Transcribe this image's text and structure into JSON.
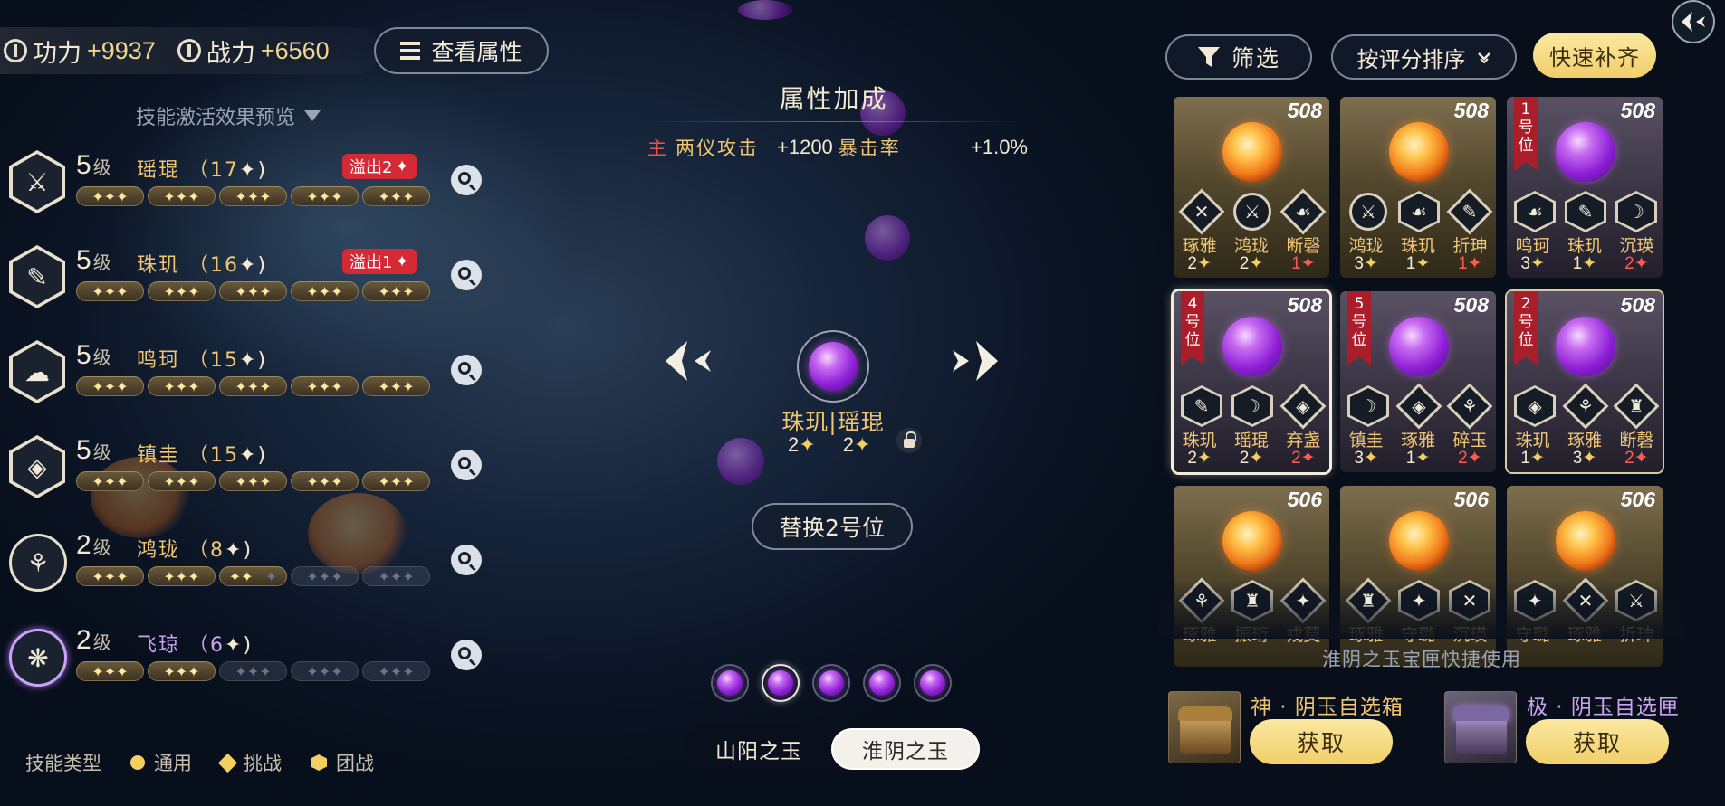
{
  "stats": {
    "gongli_label": "功力",
    "gongli_value": "+9937",
    "zhanli_label": "战力",
    "zhanli_value": "+6560",
    "view_attr_button": "查看属性"
  },
  "skill_preview": {
    "title": "技能激活效果预览",
    "level_unit": "级",
    "skills": [
      {
        "level": "5",
        "name": "瑶琨",
        "count": "（17",
        "overflow": "溢出2",
        "segments_on": 5
      },
      {
        "level": "5",
        "name": "珠玑",
        "count": "（16",
        "overflow": "溢出1",
        "segments_on": 5
      },
      {
        "level": "5",
        "name": "鸣珂",
        "count": "（15",
        "overflow": "",
        "segments_on": 5
      },
      {
        "level": "5",
        "name": "镇圭",
        "count": "（15",
        "overflow": "",
        "segments_on": 5
      },
      {
        "level": "2",
        "name": "鸿珑",
        "count": "（8",
        "overflow": "",
        "segments_on": 2.67
      },
      {
        "level": "2",
        "name": "飞琼",
        "count": "（6",
        "overflow": "",
        "segments_on": 2
      }
    ]
  },
  "legend": {
    "title": "技能类型",
    "general": "通用",
    "challenge": "挑战",
    "team": "团战"
  },
  "attr_bonus": {
    "title": "属性加成",
    "main_tag": "主",
    "attack_label": "两仪攻击",
    "attack_value": "+1200",
    "crit_label": "暴击率",
    "crit_value": "+1.0%"
  },
  "center": {
    "pair_name": "珠玑|瑶琨",
    "star_left": "2",
    "star_right": "2",
    "replace_button": "替换2号位",
    "active_page": 2,
    "page_count": 5
  },
  "tabs": {
    "tab1": "山阳之玉",
    "tab2": "淮阴之玉",
    "active": "淮阴之玉"
  },
  "right_panel": {
    "filter_button": "筛选",
    "sort_button": "按评分排序",
    "quick_fill_button": "快速补齐",
    "cards": [
      {
        "score": "508",
        "orb": "fire",
        "slot": "",
        "names": [
          "琢雅",
          "鸿珑",
          "断磬"
        ],
        "vals": [
          "2",
          "2",
          "1"
        ],
        "red": [
          false,
          false,
          true
        ]
      },
      {
        "score": "508",
        "orb": "fire",
        "slot": "",
        "names": [
          "鸿珑",
          "珠玑",
          "折珅"
        ],
        "vals": [
          "3",
          "1",
          "1"
        ],
        "red": [
          false,
          false,
          true
        ]
      },
      {
        "score": "508",
        "orb": "purple",
        "slot": "1号位",
        "names": [
          "鸣珂",
          "珠玑",
          "沉瑛"
        ],
        "vals": [
          "3",
          "1",
          "2"
        ],
        "red": [
          false,
          false,
          true
        ]
      },
      {
        "score": "508",
        "orb": "purple",
        "slot": "4号位",
        "names": [
          "珠玑",
          "瑶琨",
          "弃盏"
        ],
        "vals": [
          "2",
          "2",
          "2"
        ],
        "red": [
          false,
          false,
          true
        ]
      },
      {
        "score": "508",
        "orb": "purple",
        "slot": "5号位",
        "names": [
          "镇圭",
          "琢雅",
          "碎玉"
        ],
        "vals": [
          "3",
          "1",
          "2"
        ],
        "red": [
          false,
          false,
          true
        ]
      },
      {
        "score": "508",
        "orb": "purple",
        "slot": "2号位",
        "names": [
          "珠玑",
          "琢雅",
          "断磬"
        ],
        "vals": [
          "1",
          "3",
          "2"
        ],
        "red": [
          false,
          false,
          true
        ]
      },
      {
        "score": "506",
        "orb": "fire",
        "slot": "",
        "names": [
          "琢雅",
          "振珩",
          "戎莫"
        ],
        "vals": [
          "",
          "",
          ""
        ],
        "red": [
          false,
          false,
          false
        ]
      },
      {
        "score": "506",
        "orb": "fire",
        "slot": "",
        "names": [
          "琢雅",
          "守璐",
          "沉瑛"
        ],
        "vals": [
          "",
          "",
          ""
        ],
        "red": [
          false,
          false,
          false
        ]
      },
      {
        "score": "506",
        "orb": "fire",
        "slot": "",
        "names": [
          "守璐",
          "琢雅",
          "折珅"
        ],
        "vals": [
          "",
          "",
          ""
        ],
        "red": [
          false,
          false,
          false
        ]
      }
    ],
    "quick_use_title": "淮阴之玉宝匣快捷使用",
    "box1_name": "神 · 阴玉自选箱",
    "box2_name": "极 · 阴玉自选匣",
    "get_button": "获取"
  },
  "colors": {
    "gold_text": "#f0c674",
    "purple_text": "#c9a4f2",
    "overflow_red": "#d42a35",
    "button_gold": "#f1cf6a"
  }
}
